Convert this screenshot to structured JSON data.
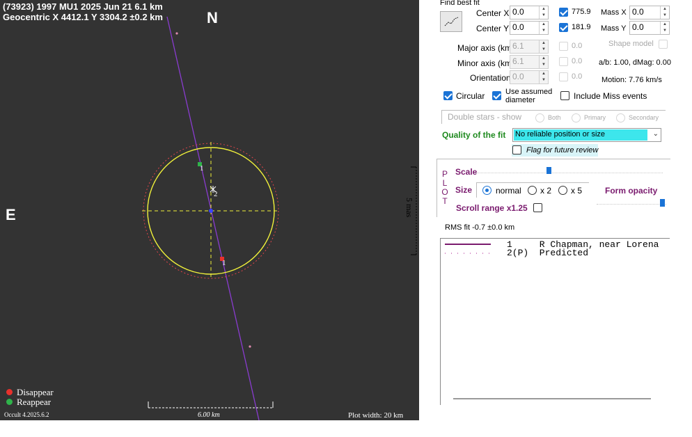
{
  "plot": {
    "title_line1": "(73923) 1997 MU1  2025 Jun 21   6.1 km",
    "title_line2": "Geocentric  X  4412.1  Y 3304.2 ±0.2 km",
    "north_label": "N",
    "east_label": "E",
    "legend_disappear": "Disappear",
    "legend_reappear": "Reappear",
    "version": "Occult 4.2025.6.2",
    "scale_bar_label": "6.00 km",
    "plot_width": "Plot width: 20 km",
    "chord_label_1a": "1",
    "chord_label_2": "2",
    "chord_label_1b": "1",
    "colors": {
      "disappear": "#e8312c",
      "reappear": "#2fb34a",
      "ellipse": "#f2f23a",
      "chord": "#8a3cd0"
    }
  },
  "scale_strip": {
    "label": "5 mas"
  },
  "panel": {
    "find_best_fit": "Find best fit",
    "center_x_label": "Center X",
    "center_x_value": "0.0",
    "center_y_label": "Center Y",
    "center_y_value": "0.0",
    "rms_x": "775.9",
    "rms_y": "181.9",
    "mass_x_label": "Mass X",
    "mass_x_value": "0.0",
    "mass_y_label": "Mass Y",
    "mass_y_value": "0.0",
    "major_axis_label": "Major axis (km)",
    "major_axis_value": "6.1",
    "major_axis_extra": "0.0",
    "minor_axis_label": "Minor axis (km)",
    "minor_axis_value": "6.1",
    "minor_axis_extra": "0.0",
    "orientation_label": "Orientation",
    "orientation_value": "0.0",
    "orientation_extra": "0.0",
    "shape_model": "Shape model",
    "ab_dmag": "a/b: 1.00, dMag: 0.00",
    "motion": "Motion: 7.76 km/s",
    "circular_label": "Circular",
    "use_assumed_line1": "Use assumed",
    "use_assumed_line2": "diameter",
    "include_miss_label": "Include Miss events",
    "double_stars_label": "Double stars - show",
    "double_both": "Both",
    "double_primary": "Primary",
    "double_secondary": "Secondary",
    "quality_label": "Quality of the fit",
    "quality_value": "No reliable position or size",
    "flag_label": "Flag for future review",
    "plot_letters": [
      "P",
      "L",
      "O",
      "T"
    ],
    "scale_label": "Scale",
    "size_label": "Size",
    "size_normal": "normal",
    "size_x2": "x 2",
    "size_x5": "x 5",
    "form_opacity": "Form opacity",
    "scroll_range": "Scroll range x1.25",
    "rms_fit": "RMS fit -0.7 ±0.0 km",
    "observers": [
      {
        "text": "1     R Chapman, near Lorena"
      },
      {
        "text": "2(P)  Predicted"
      }
    ]
  }
}
